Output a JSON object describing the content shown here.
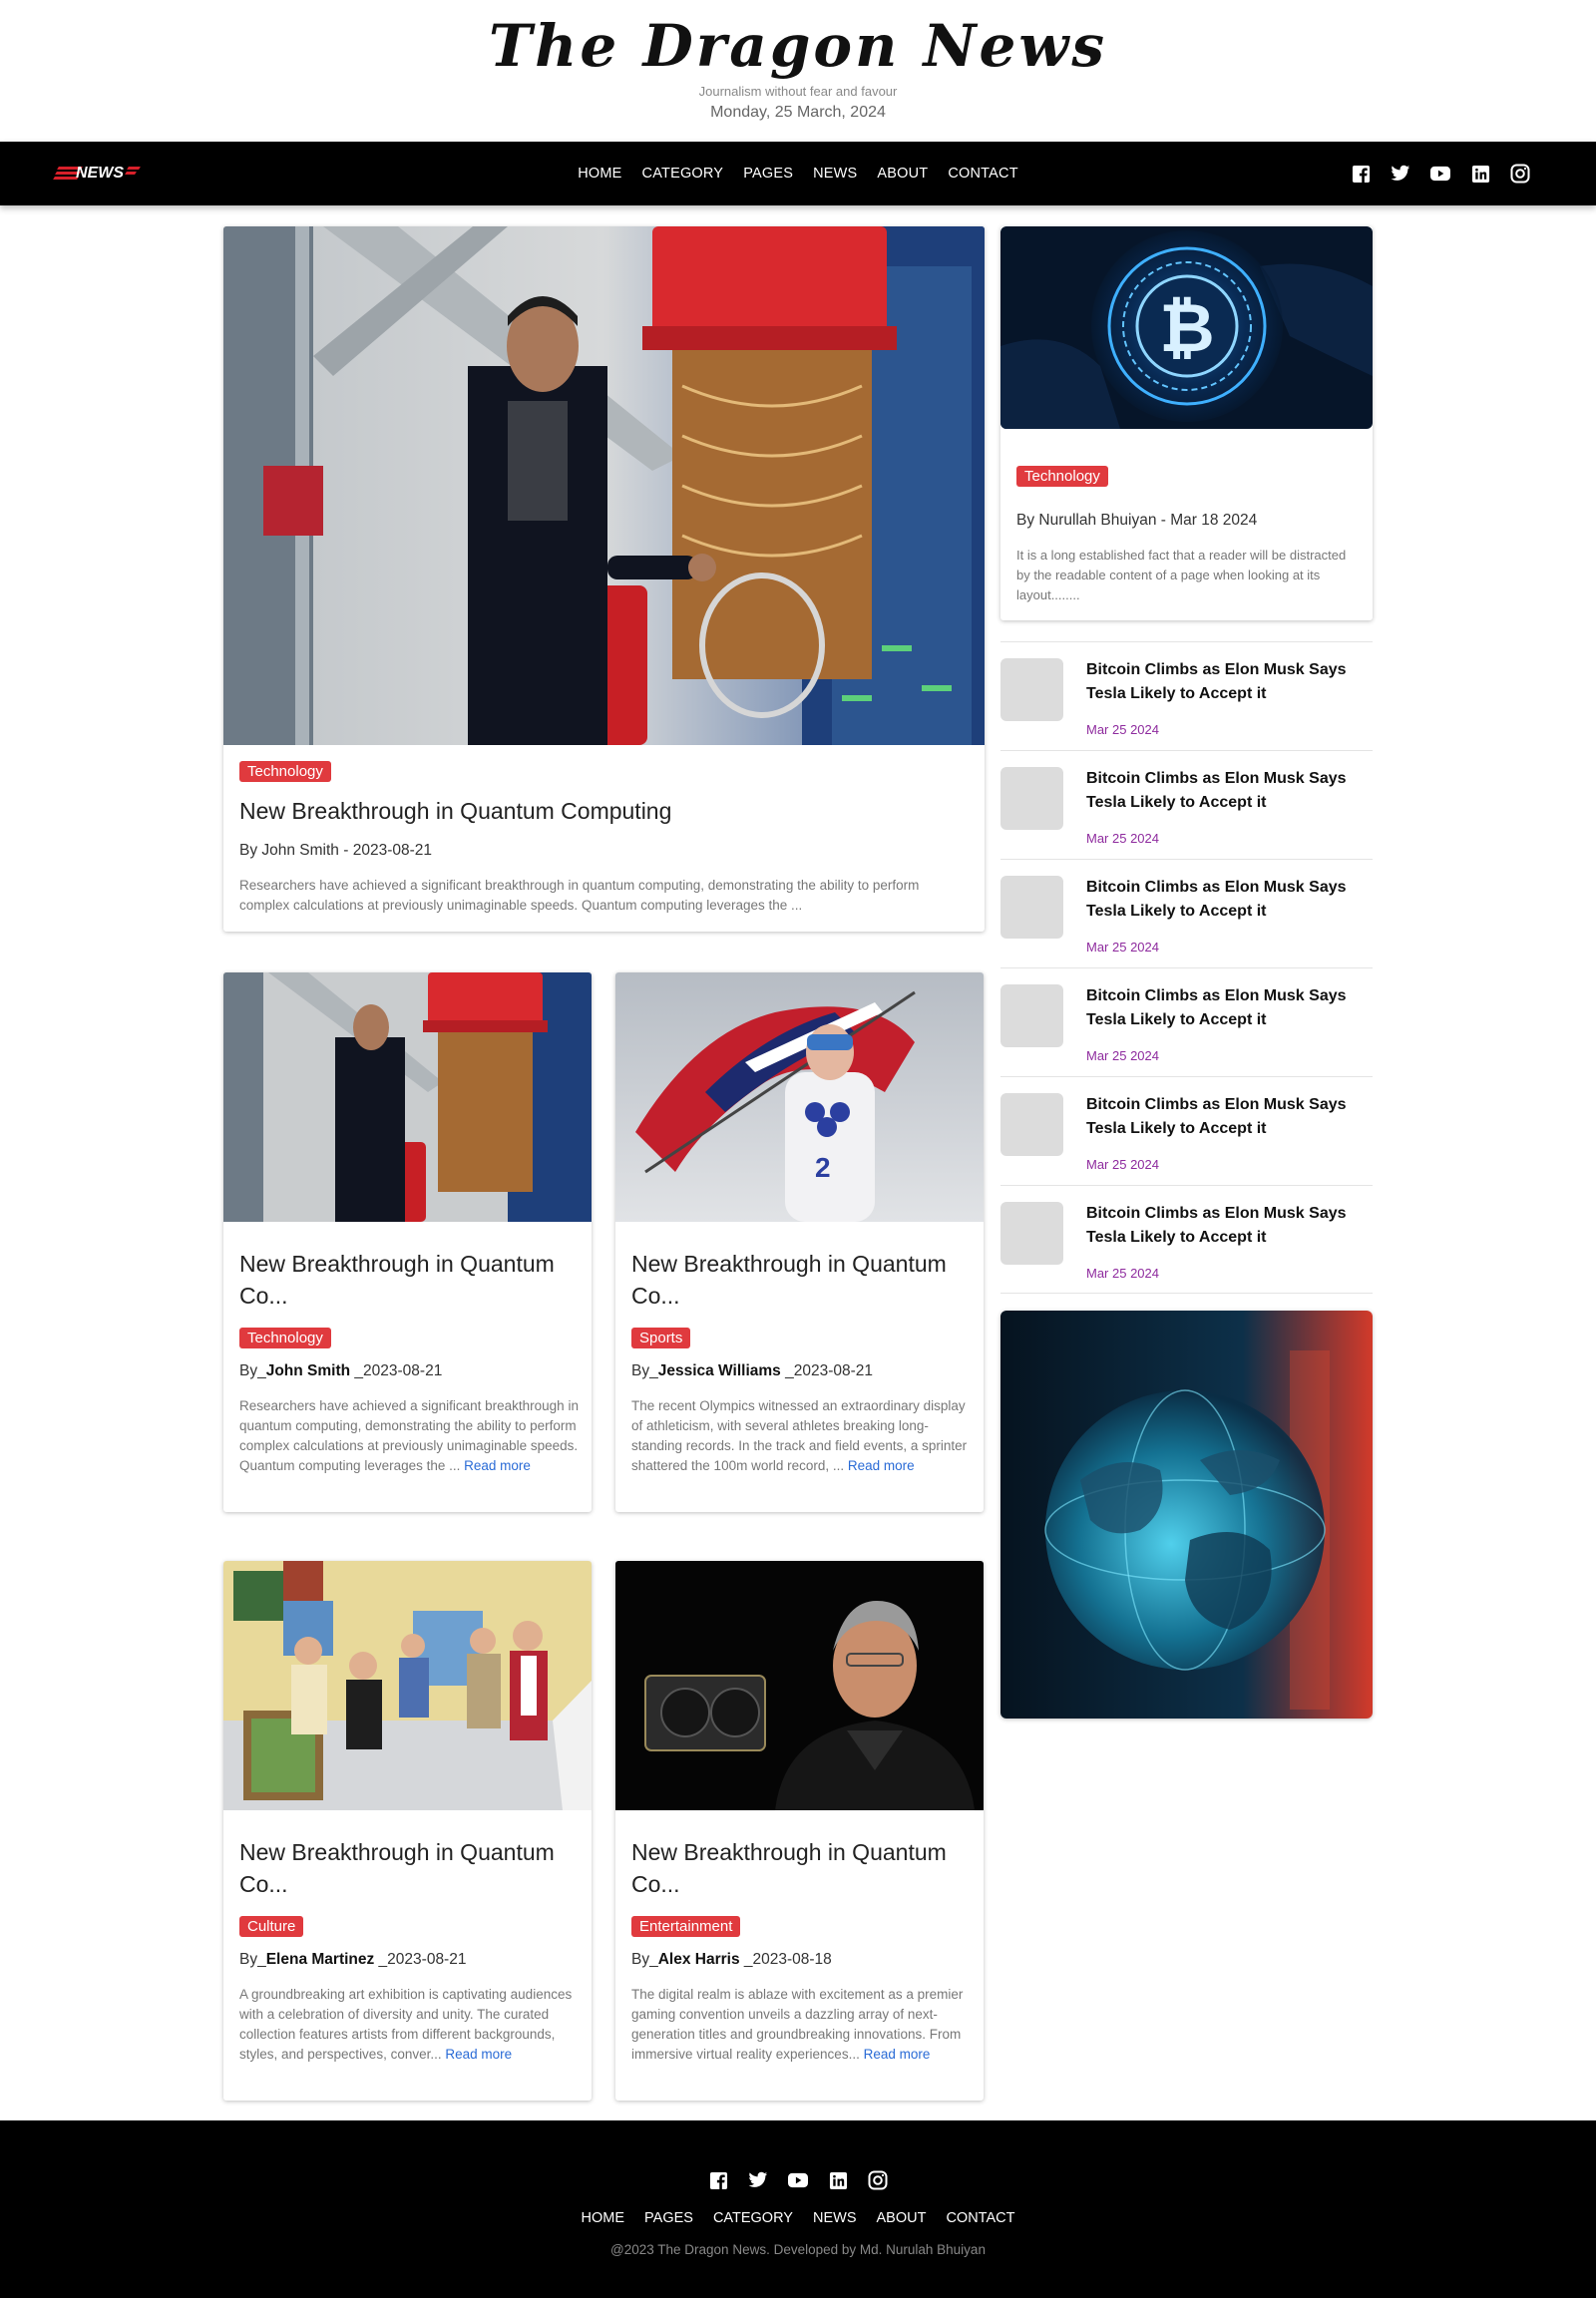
{
  "masthead": {
    "brand": "The Dragon News",
    "tagline": "Journalism without fear and favour",
    "date": "Monday, 25 March, 2024"
  },
  "nav": {
    "logo_text": "NEWS",
    "links": [
      "HOME",
      "CATEGORY",
      "PAGES",
      "NEWS",
      "ABOUT",
      "CONTACT"
    ],
    "social_icons": [
      "facebook-icon",
      "twitter-icon",
      "youtube-icon",
      "linkedin-icon",
      "instagram-icon"
    ]
  },
  "featured": {
    "category": "Technology",
    "title": "New Breakthrough in Quantum Computing",
    "byline": "By John Smith - 2023-08-21",
    "excerpt": "Researchers have achieved a significant breakthrough in quantum computing, demonstrating the ability to perform complex calculations at previously unimaginable speeds. Quantum computing leverages the ..."
  },
  "cards": [
    {
      "title": "New Breakthrough in Quantum Co...",
      "category": "Technology",
      "by_prefix": "By_",
      "author": "John Smith",
      "date": " _2023-08-21",
      "excerpt": "Researchers have achieved a significant breakthrough in quantum computing, demonstrating the ability to perform complex calculations at previously unimaginable speeds. Quantum computing leverages the ... ",
      "read_more": "Read more"
    },
    {
      "title": "New Breakthrough in Quantum Co...",
      "category": "Sports",
      "by_prefix": "By_",
      "author": "Jessica Williams",
      "date": " _2023-08-21",
      "excerpt": "The recent Olympics witnessed an extraordinary display of athleticism, with several athletes breaking long-standing records. In the track and field events, a sprinter shattered the 100m world record, ... ",
      "read_more": "Read more"
    },
    {
      "title": "New Breakthrough in Quantum Co...",
      "category": "Culture",
      "by_prefix": "By_",
      "author": "Elena Martinez",
      "date": " _2023-08-21",
      "excerpt": "A groundbreaking art exhibition is captivating audiences with a celebration of diversity and unity. The curated collection features artists from different backgrounds, styles, and perspectives, conver... ",
      "read_more": "Read more"
    },
    {
      "title": "New Breakthrough in Quantum Co...",
      "category": "Entertainment",
      "by_prefix": "By_",
      "author": "Alex Harris",
      "date": " _2023-08-18",
      "excerpt": "The digital realm is ablaze with excitement as a premier gaming convention unveils a dazzling array of next-generation titles and groundbreaking innovations. From immersive virtual reality experiences... ",
      "read_more": "Read more"
    }
  ],
  "sidebar": {
    "top_card": {
      "category": "Technology",
      "byline": "By Nurullah Bhuiyan - Mar 18 2024",
      "excerpt": "It is a long established fact that a reader will be distracted by the readable content of a page when looking at its layout........"
    },
    "items": [
      {
        "title": "Bitcoin Climbs as Elon Musk Says Tesla Likely to Accept it",
        "date": "Mar 25 2024"
      },
      {
        "title": "Bitcoin Climbs as Elon Musk Says Tesla Likely to Accept it",
        "date": "Mar 25 2024"
      },
      {
        "title": "Bitcoin Climbs as Elon Musk Says Tesla Likely to Accept it",
        "date": "Mar 25 2024"
      },
      {
        "title": "Bitcoin Climbs as Elon Musk Says Tesla Likely to Accept it",
        "date": "Mar 25 2024"
      },
      {
        "title": "Bitcoin Climbs as Elon Musk Says Tesla Likely to Accept it",
        "date": "Mar 25 2024"
      },
      {
        "title": "Bitcoin Climbs as Elon Musk Says Tesla Likely to Accept it",
        "date": "Mar 25 2024"
      }
    ]
  },
  "footer": {
    "links": [
      "HOME",
      "PAGES",
      "CATEGORY",
      "NEWS",
      "ABOUT",
      "CONTACT"
    ],
    "copyright": "@2023 The Dragon News. Developed by Md. Nurulah Bhuiyan"
  },
  "colors": {
    "badge": "#e03a3e",
    "date_purple": "#8e2b9e",
    "link_blue": "#2a6bd6",
    "nav_bg": "#000000"
  }
}
